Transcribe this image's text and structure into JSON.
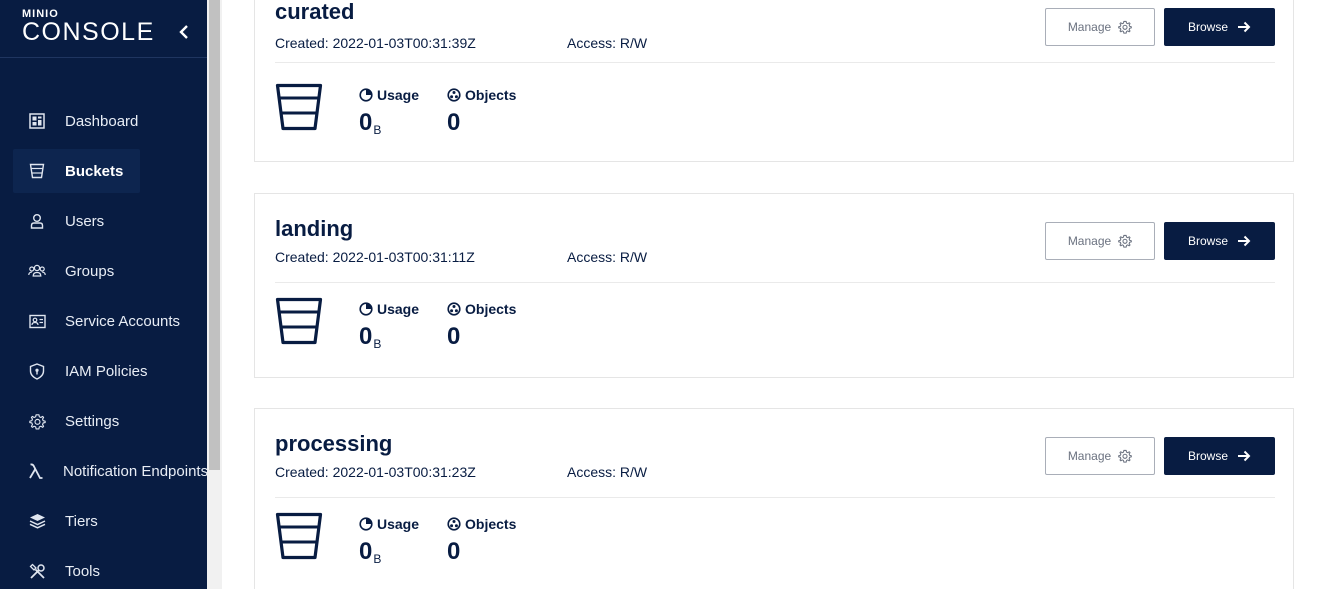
{
  "sidebar": {
    "brand": "MINIO",
    "product": "CONSOLE",
    "items": [
      {
        "label": "Dashboard",
        "icon": "dashboard-icon",
        "active": false
      },
      {
        "label": "Buckets",
        "icon": "bucket-icon",
        "active": true
      },
      {
        "label": "Users",
        "icon": "user-icon",
        "active": false
      },
      {
        "label": "Groups",
        "icon": "groups-icon",
        "active": false
      },
      {
        "label": "Service Accounts",
        "icon": "service-accounts-icon",
        "active": false
      },
      {
        "label": "IAM Policies",
        "icon": "shield-icon",
        "active": false
      },
      {
        "label": "Settings",
        "icon": "gear-icon",
        "active": false
      },
      {
        "label": "Notification Endpoints",
        "icon": "lambda-icon",
        "active": false
      },
      {
        "label": "Tiers",
        "icon": "layers-icon",
        "active": false
      },
      {
        "label": "Tools",
        "icon": "tools-icon",
        "active": false
      }
    ]
  },
  "labels": {
    "manage": "Manage",
    "browse": "Browse",
    "usage": "Usage",
    "objects": "Objects"
  },
  "buckets": [
    {
      "name": "curated",
      "created": "Created: 2022-01-03T00:31:39Z",
      "access": "Access: R/W",
      "usage_value": "0",
      "usage_unit": "B",
      "objects": "0"
    },
    {
      "name": "landing",
      "created": "Created: 2022-01-03T00:31:11Z",
      "access": "Access: R/W",
      "usage_value": "0",
      "usage_unit": "B",
      "objects": "0"
    },
    {
      "name": "processing",
      "created": "Created: 2022-01-03T00:31:23Z",
      "access": "Access: R/W",
      "usage_value": "0",
      "usage_unit": "B",
      "objects": "0"
    }
  ],
  "colors": {
    "sidebar_bg": "#081c42",
    "accent": "#081c42",
    "card_border": "#e5e5e5"
  }
}
